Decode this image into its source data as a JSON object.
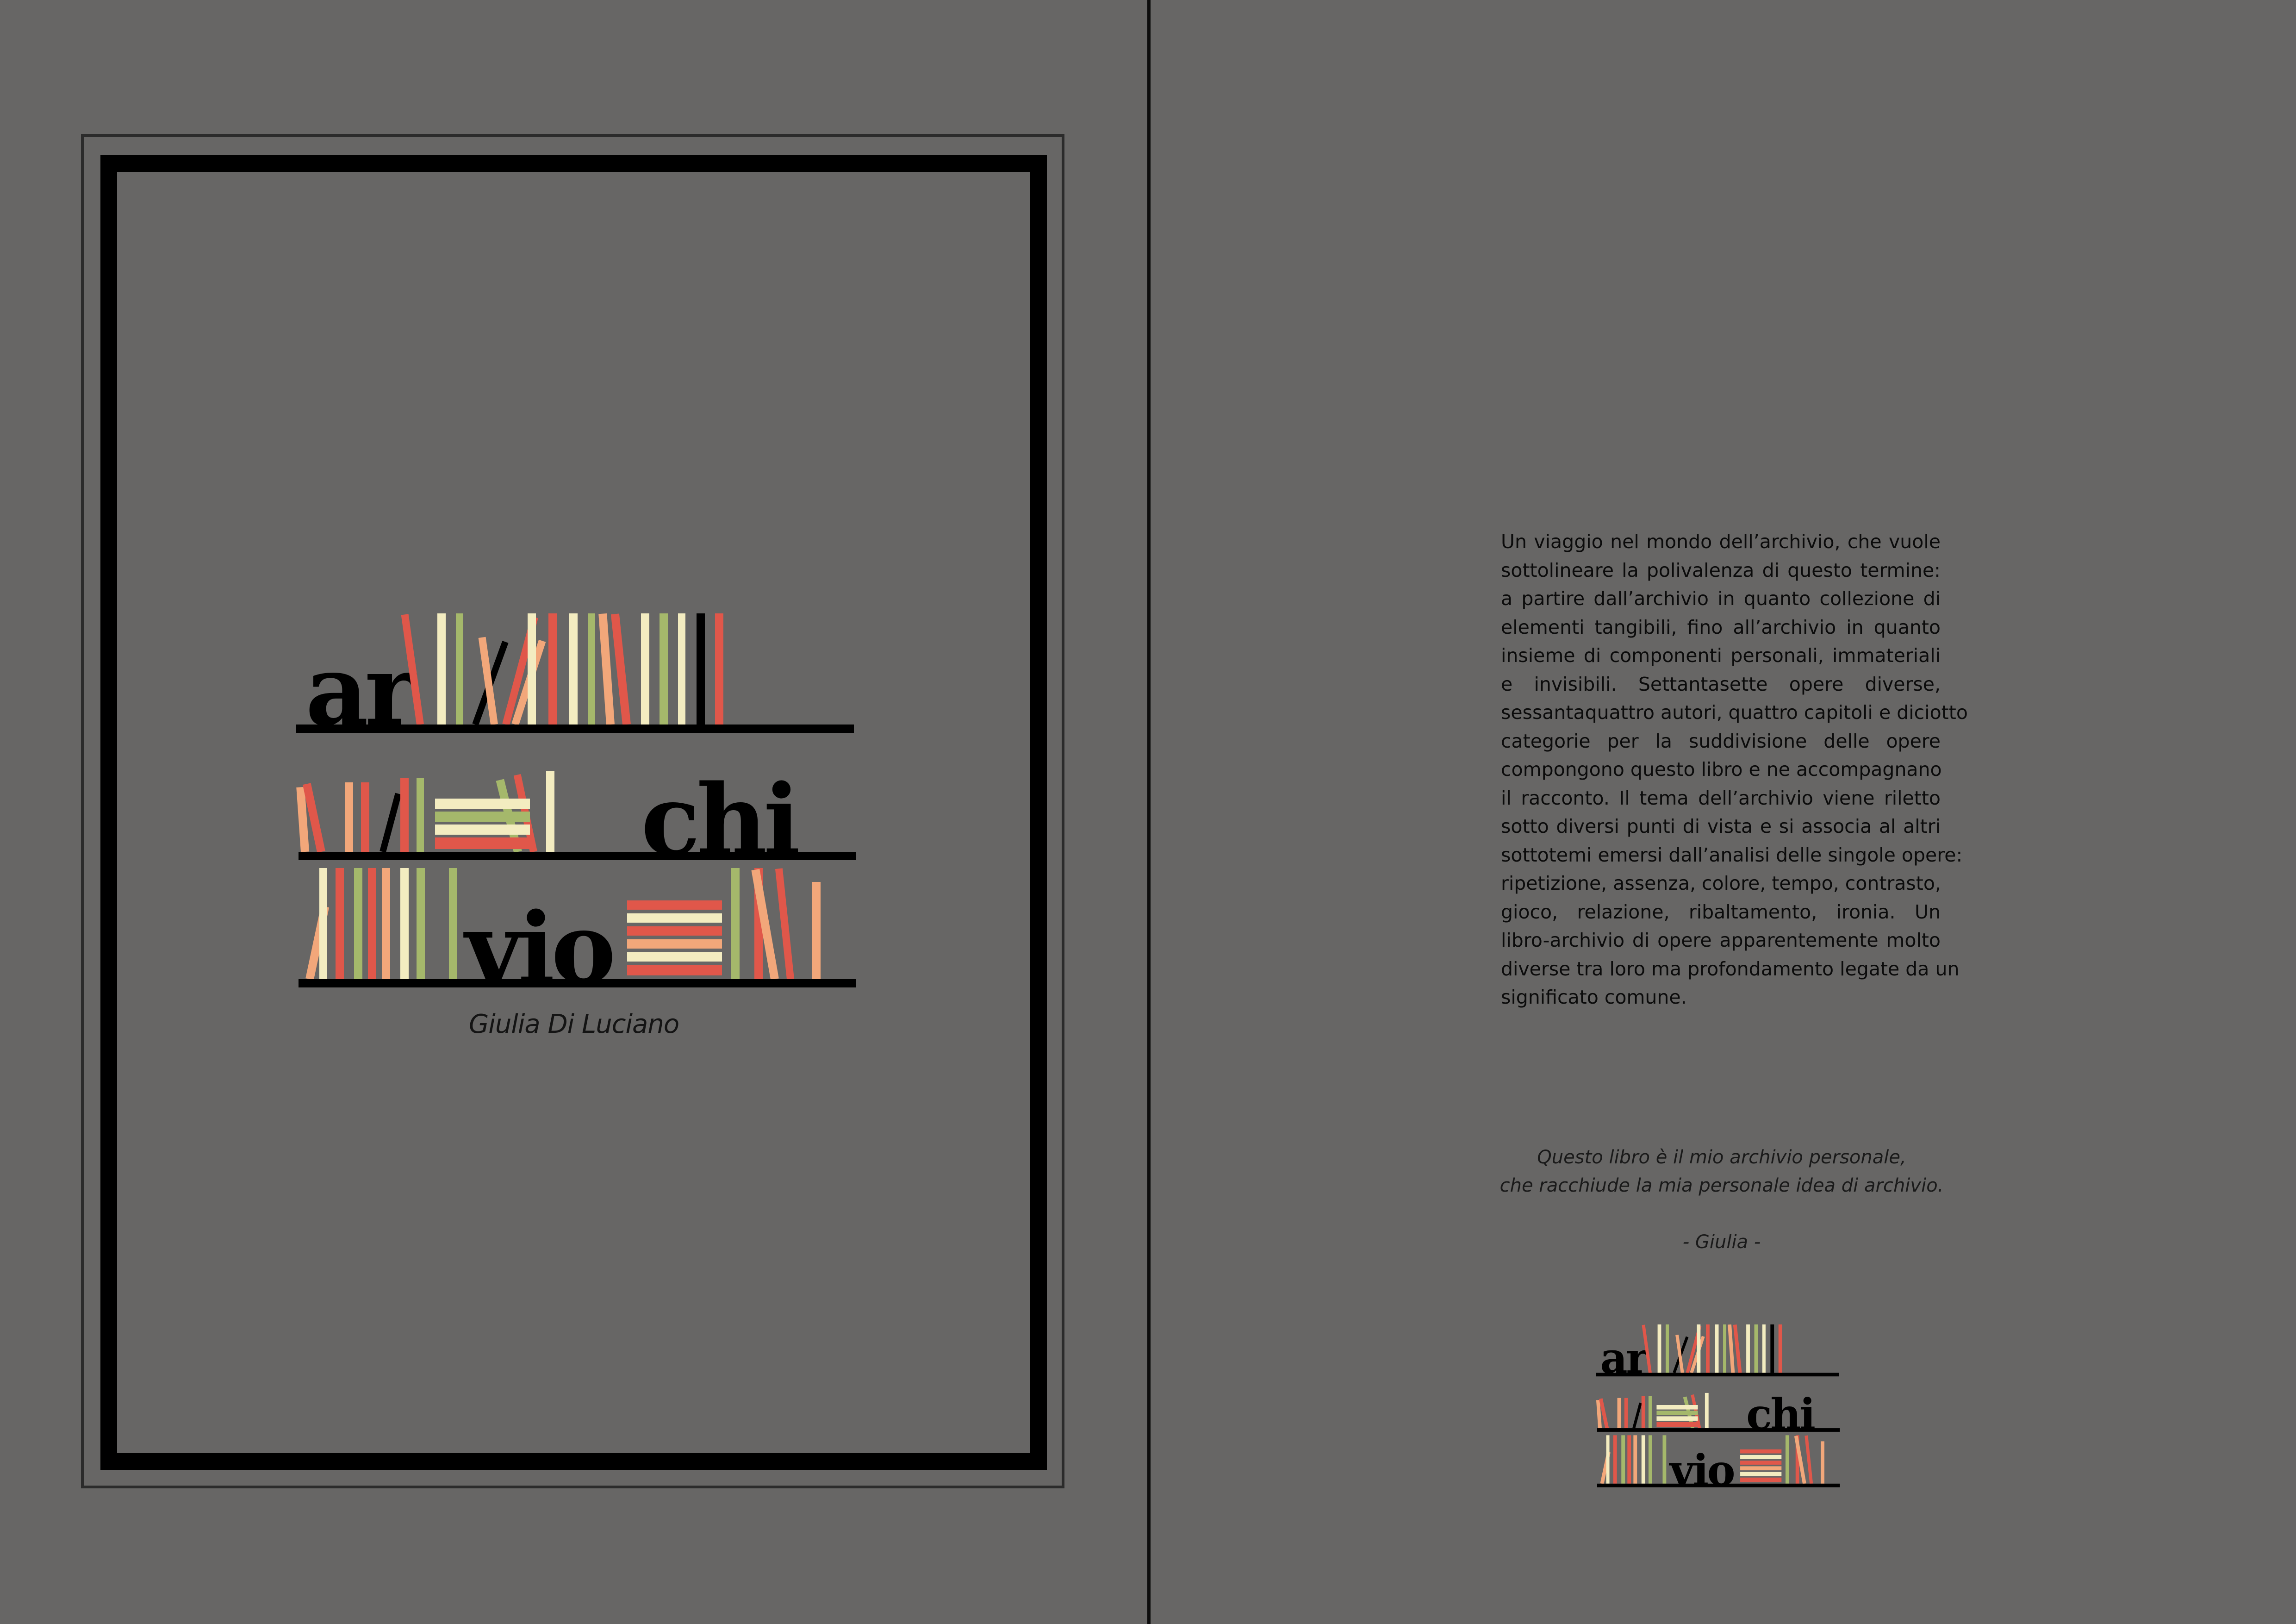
{
  "cover": {
    "logo_rows": [
      "ar",
      "chi",
      "vio"
    ],
    "author": "Giulia Di Luciano"
  },
  "back": {
    "blurb_lines": [
      "Un viaggio nel mondo dell’archivio, che vuole",
      "sottolineare la polivalenza di questo termine:",
      "a partire dall’archivio in quanto collezione di",
      "elementi tangibili, fino all’archivio in quanto",
      "insieme di componenti personali, immateriali",
      "e invisibili. Settantasette opere diverse,",
      "sessantaquattro autori, quattro capitoli e diciotto",
      "categorie per la suddivisione delle opere",
      "compongono questo libro e ne accompagnano",
      "il racconto. Il tema dell’archivio viene riletto",
      "sotto diversi punti di vista e si associa al altri",
      "sottotemi emersi dall’analisi delle singole opere:",
      "ripetizione, assenza, colore, tempo, contrasto,",
      "gioco, relazione, ribaltamento, ironia. Un",
      "libro-archivio di opere apparentemente molto",
      "diverse tra loro ma profondamento legate da un",
      "significato comune."
    ],
    "quote_line1": "Questo libro è il mio archivio personale,",
    "quote_line2": "che racchiude la mia personale idea di archivio.",
    "signature": "- Giulia -",
    "logo_rows": [
      "ar",
      "chi",
      "vio"
    ]
  },
  "colors": {
    "background": "#676665",
    "red": "#e0574a",
    "cream": "#f3ecc0",
    "green": "#a5b86b",
    "peach": "#f2a77a",
    "black": "#000000"
  }
}
